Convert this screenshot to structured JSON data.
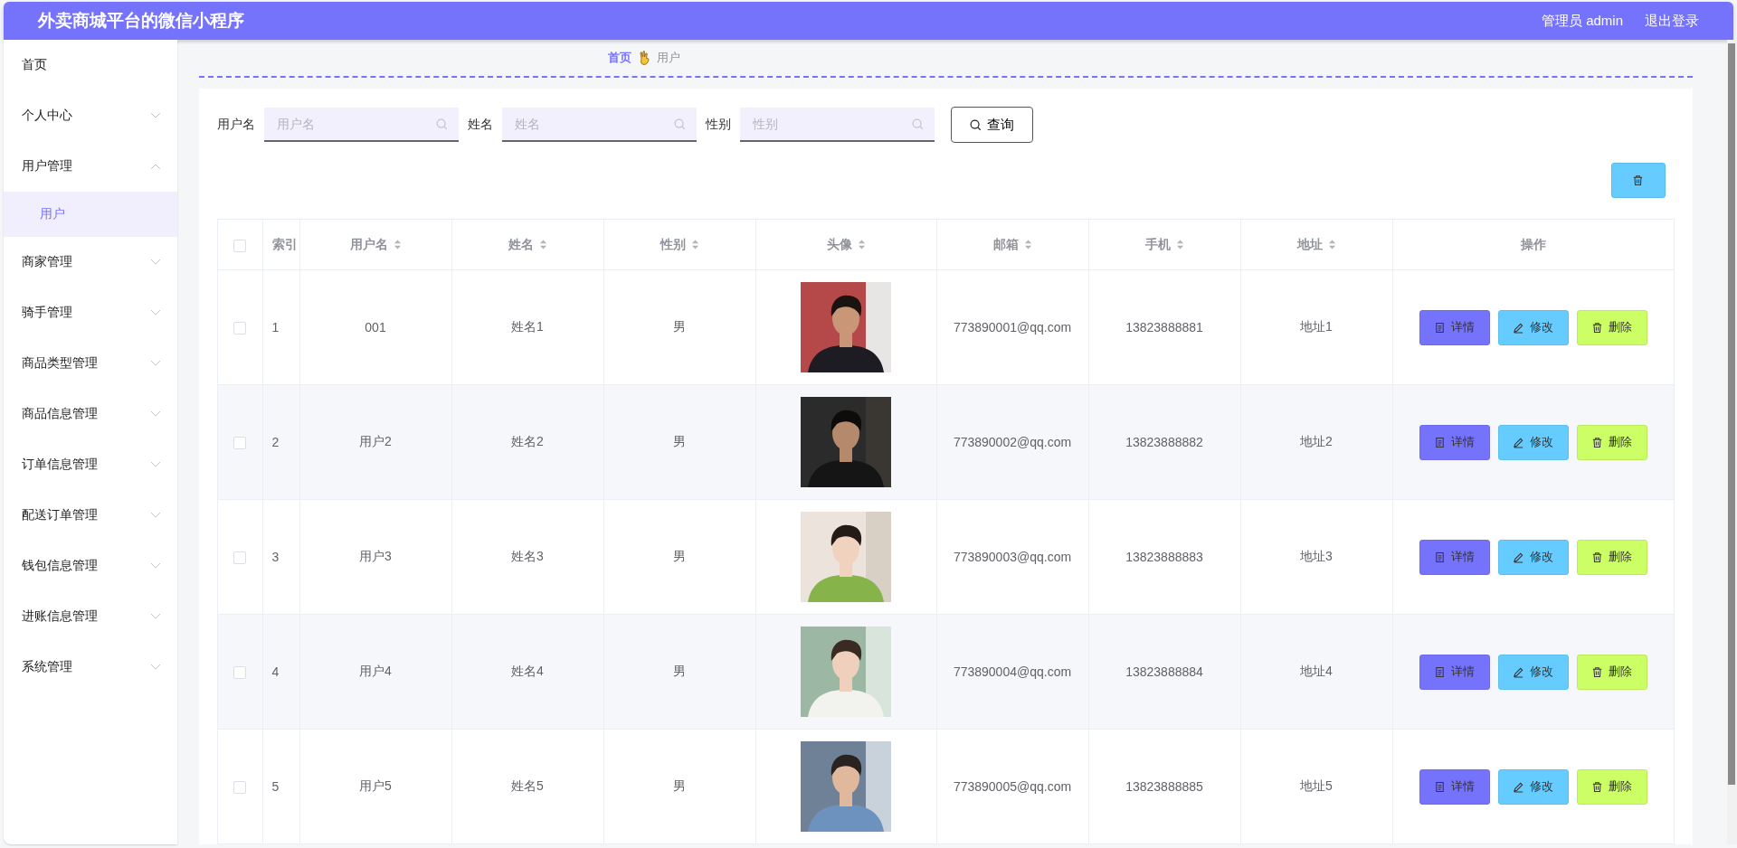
{
  "header": {
    "title": "外卖商城平台的微信小程序",
    "user": "管理员 admin",
    "logout": "退出登录"
  },
  "sidebar": {
    "items": [
      {
        "label": "首页",
        "kind": "link"
      },
      {
        "label": "个人中心",
        "kind": "submenu",
        "expanded": false
      },
      {
        "label": "用户管理",
        "kind": "submenu",
        "expanded": true,
        "children": [
          {
            "label": "用户",
            "selected": true
          }
        ]
      },
      {
        "label": "商家管理",
        "kind": "submenu",
        "expanded": false
      },
      {
        "label": "骑手管理",
        "kind": "submenu",
        "expanded": false
      },
      {
        "label": "商品类型管理",
        "kind": "submenu",
        "expanded": false
      },
      {
        "label": "商品信息管理",
        "kind": "submenu",
        "expanded": false
      },
      {
        "label": "订单信息管理",
        "kind": "submenu",
        "expanded": false
      },
      {
        "label": "配送订单管理",
        "kind": "submenu",
        "expanded": false
      },
      {
        "label": "钱包信息管理",
        "kind": "submenu",
        "expanded": false
      },
      {
        "label": "进账信息管理",
        "kind": "submenu",
        "expanded": false
      },
      {
        "label": "系统管理",
        "kind": "submenu",
        "expanded": false
      }
    ]
  },
  "breadcrumb": [
    "首页",
    "用户"
  ],
  "search": {
    "fields": [
      {
        "label": "用户名",
        "placeholder": "用户名"
      },
      {
        "label": "姓名",
        "placeholder": "姓名"
      },
      {
        "label": "性别",
        "placeholder": "性别"
      }
    ],
    "button": "查询"
  },
  "table": {
    "select_all": {
      "checked": false
    },
    "columns": [
      {
        "label": "索引",
        "sortable": false
      },
      {
        "label": "用户名",
        "sortable": true
      },
      {
        "label": "姓名",
        "sortable": true
      },
      {
        "label": "性别",
        "sortable": true
      },
      {
        "label": "头像",
        "sortable": true
      },
      {
        "label": "邮箱",
        "sortable": true
      },
      {
        "label": "手机",
        "sortable": true
      },
      {
        "label": "地址",
        "sortable": true
      },
      {
        "label": "操作",
        "sortable": false
      }
    ],
    "rows": [
      {
        "checked": false,
        "index": "1",
        "username": "001",
        "name": "姓名1",
        "gender": "男",
        "email": "773890001@qq.com",
        "phone": "13823888881",
        "address": "地址1",
        "actions": [
          "详情",
          "修改",
          "删除"
        ]
      },
      {
        "checked": false,
        "index": "2",
        "username": "用户2",
        "name": "姓名2",
        "gender": "男",
        "email": "773890002@qq.com",
        "phone": "13823888882",
        "address": "地址2",
        "actions": [
          "详情",
          "修改",
          "删除"
        ]
      },
      {
        "checked": false,
        "index": "3",
        "username": "用户3",
        "name": "姓名3",
        "gender": "男",
        "email": "773890003@qq.com",
        "phone": "13823888883",
        "address": "地址3",
        "actions": [
          "详情",
          "修改",
          "删除"
        ]
      },
      {
        "checked": false,
        "index": "4",
        "username": "用户4",
        "name": "姓名4",
        "gender": "男",
        "email": "773890004@qq.com",
        "phone": "13823888884",
        "address": "地址4",
        "actions": [
          "详情",
          "修改",
          "删除"
        ]
      },
      {
        "checked": false,
        "index": "5",
        "username": "用户5",
        "name": "姓名5",
        "gender": "男",
        "email": "773890005@qq.com",
        "phone": "13823888885",
        "address": "地址5",
        "actions": [
          "详情",
          "修改",
          "删除"
        ]
      }
    ]
  }
}
